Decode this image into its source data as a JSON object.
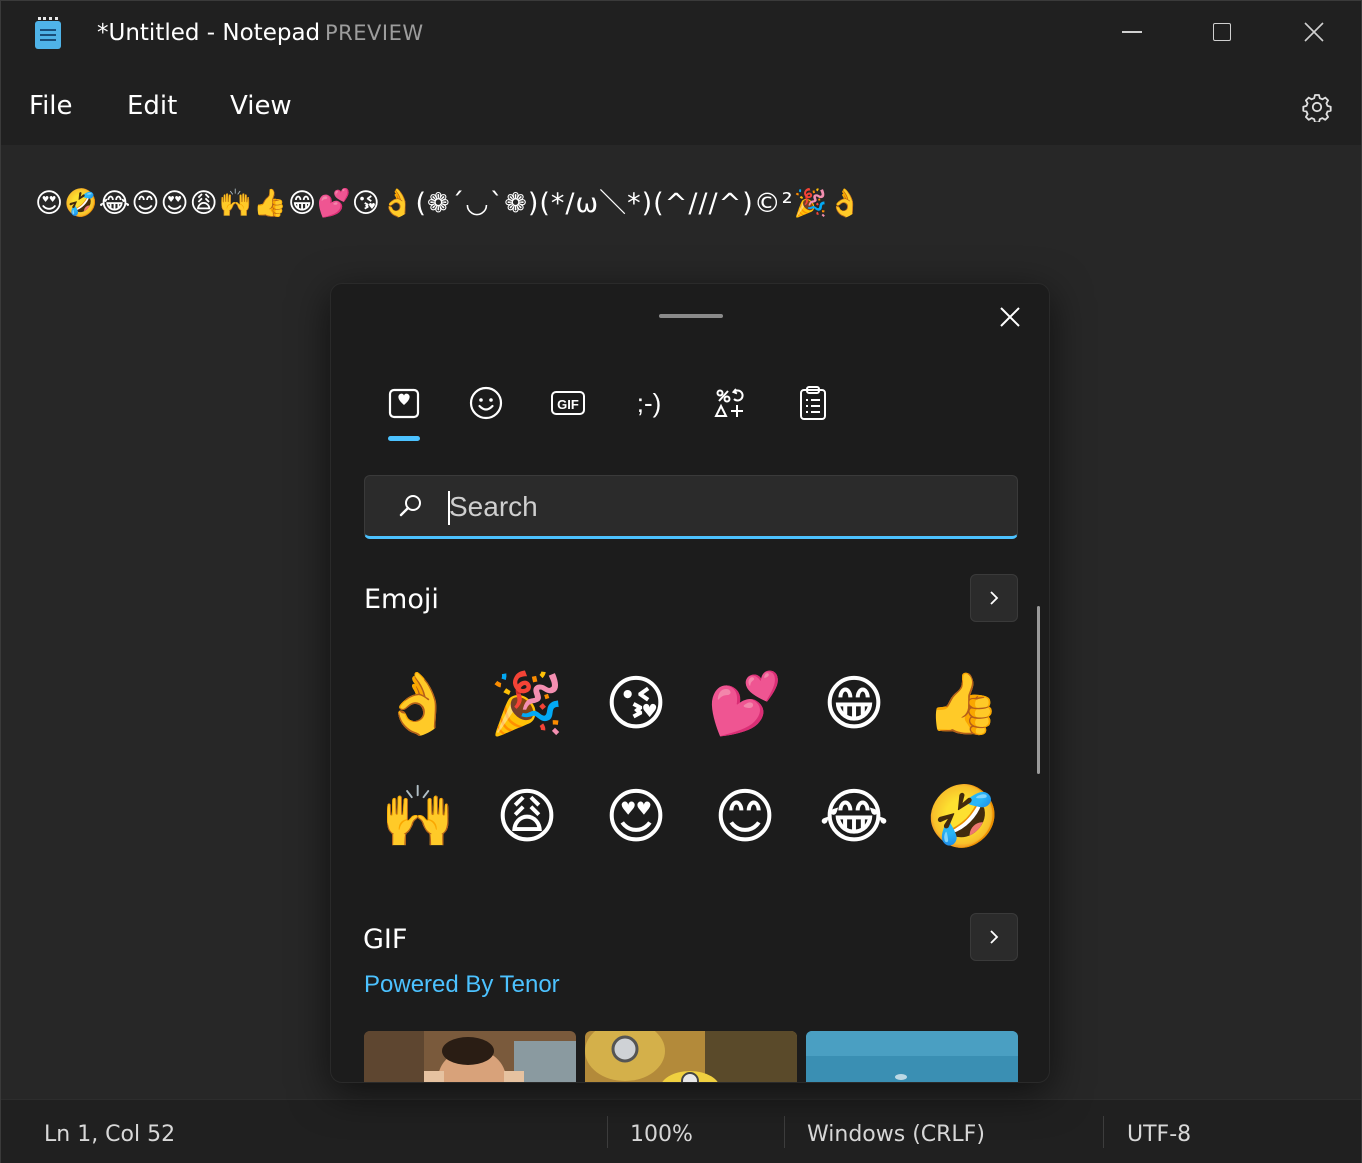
{
  "window": {
    "title": "*Untitled - Notepad",
    "badge": "PREVIEW"
  },
  "menu": {
    "items": [
      "File",
      "Edit",
      "View"
    ]
  },
  "editor": {
    "content": "😍🤣😂😊😍😩🙌👍😁💕😘👌(❁´◡`❁)(*/ω＼*)(^///^)©²🎉👌"
  },
  "status": {
    "position": "Ln 1, Col 52",
    "zoom": "100%",
    "line_ending": "Windows (CRLF)",
    "encoding": "UTF-8"
  },
  "emoji_panel": {
    "tabs": [
      {
        "name": "favorites-tab",
        "icon": "heart-clipboard-icon",
        "selected": true
      },
      {
        "name": "emoji-tab",
        "icon": "smiley-icon",
        "selected": false
      },
      {
        "name": "gif-tab",
        "icon": "gif-icon",
        "label": "GIF",
        "selected": false
      },
      {
        "name": "kaomoji-tab",
        "icon": "kaomoji-icon",
        "label": ";-)",
        "selected": false
      },
      {
        "name": "symbols-tab",
        "icon": "symbols-icon",
        "selected": false
      },
      {
        "name": "clipboard-tab",
        "icon": "clipboard-icon",
        "selected": false
      }
    ],
    "search": {
      "placeholder": "Search"
    },
    "emoji_section": {
      "title": "Emoji",
      "items": [
        "👌",
        "🎉",
        "😘",
        "💕",
        "😁",
        "👍",
        "🙌",
        "😩",
        "😍",
        "😊",
        "😂",
        "🤣"
      ]
    },
    "gif_section": {
      "title": "GIF",
      "powered_by": "Powered By Tenor"
    },
    "accent_color": "#4cc2ff"
  }
}
